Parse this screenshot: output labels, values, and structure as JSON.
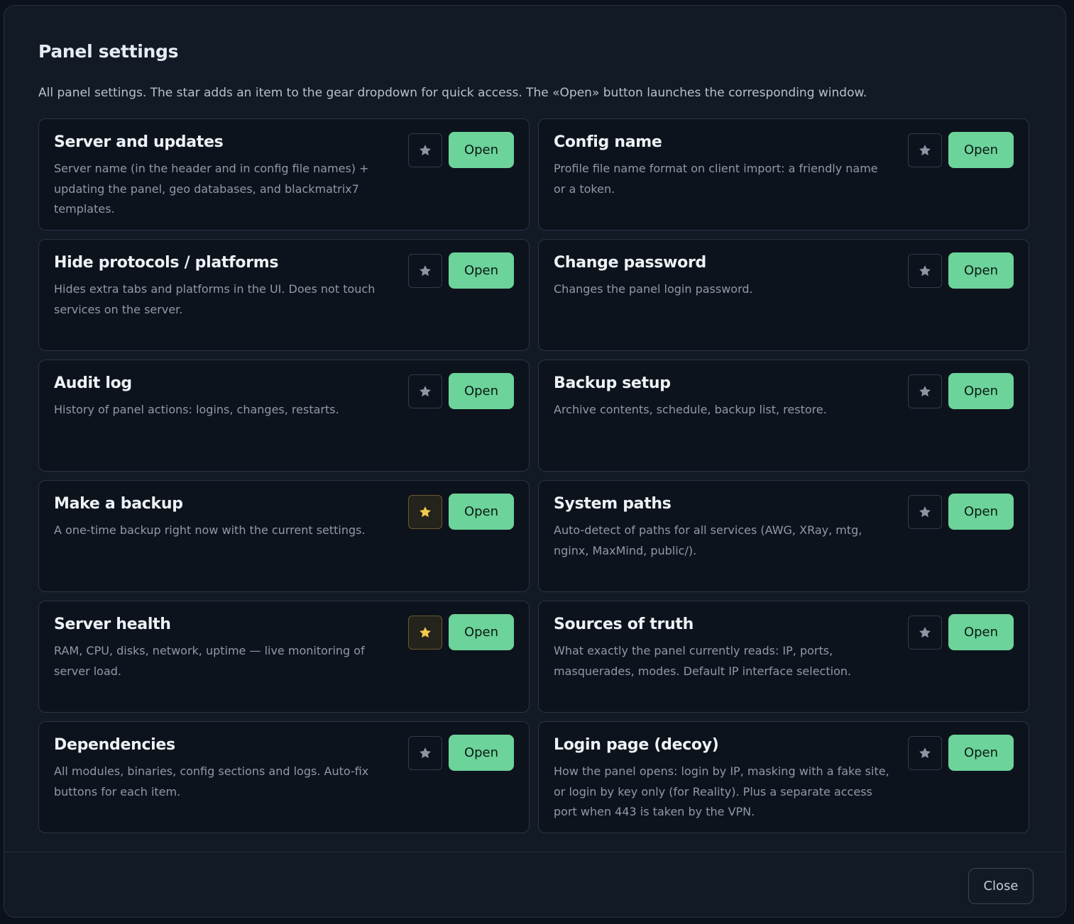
{
  "modal": {
    "title": "Panel settings",
    "subtitle": "All panel settings. The star adds an item to the gear dropdown for quick access. The «Open» button launches the corresponding window.",
    "close_label": "Close"
  },
  "colors": {
    "open_button": "#6cd39a",
    "star_active": "#f2c94c",
    "star_inactive": "#8b95a3"
  },
  "cards": [
    {
      "title": "Server and updates",
      "desc": "Server name (in the header and in config file names) + updating the panel, geo databases, and blackmatrix7 templates.",
      "starred": false,
      "open_label": "Open",
      "star_icon": "star-icon"
    },
    {
      "title": "Config name",
      "desc": "Profile file name format on client import: a friendly name or a token.",
      "starred": false,
      "open_label": "Open",
      "star_icon": "star-icon"
    },
    {
      "title": "Hide protocols / platforms",
      "desc": "Hides extra tabs and platforms in the UI. Does not touch services on the server.",
      "starred": false,
      "open_label": "Open",
      "star_icon": "star-icon"
    },
    {
      "title": "Change password",
      "desc": "Changes the panel login password.",
      "starred": false,
      "open_label": "Open",
      "star_icon": "star-icon"
    },
    {
      "title": "Audit log",
      "desc": "History of panel actions: logins, changes, restarts.",
      "starred": false,
      "open_label": "Open",
      "star_icon": "star-icon"
    },
    {
      "title": "Backup setup",
      "desc": "Archive contents, schedule, backup list, restore.",
      "starred": false,
      "open_label": "Open",
      "star_icon": "star-icon"
    },
    {
      "title": "Make a backup",
      "desc": "A one-time backup right now with the current settings.",
      "starred": true,
      "open_label": "Open",
      "star_icon": "star-icon"
    },
    {
      "title": "System paths",
      "desc": "Auto-detect of paths for all services (AWG, XRay, mtg, nginx, MaxMind, public/).",
      "starred": false,
      "open_label": "Open",
      "star_icon": "star-icon"
    },
    {
      "title": "Server health",
      "desc": "RAM, CPU, disks, network, uptime — live monitoring of server load.",
      "starred": true,
      "open_label": "Open",
      "star_icon": "star-icon"
    },
    {
      "title": "Sources of truth",
      "desc": "What exactly the panel currently reads: IP, ports, masquerades, modes. Default IP interface selection.",
      "starred": false,
      "open_label": "Open",
      "star_icon": "star-icon"
    },
    {
      "title": "Dependencies",
      "desc": "All modules, binaries, config sections and logs. Auto-fix buttons for each item.",
      "starred": false,
      "open_label": "Open",
      "star_icon": "star-icon"
    },
    {
      "title": "Login page (decoy)",
      "desc": "How the panel opens: login by IP, masking with a fake site, or login by key only (for Reality). Plus a separate access port when 443 is taken by the VPN.",
      "starred": false,
      "open_label": "Open",
      "star_icon": "star-icon"
    }
  ]
}
